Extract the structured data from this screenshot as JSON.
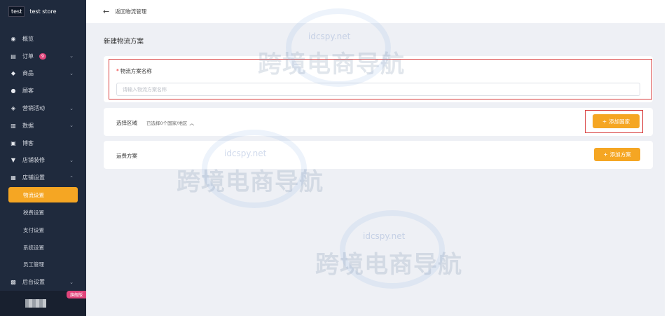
{
  "brand": {
    "logo": "test",
    "store_name": "test store"
  },
  "sidebar": {
    "items": [
      {
        "label": "概览",
        "icon": "dashboard-icon",
        "has_chevron": false
      },
      {
        "label": "订单",
        "icon": "order-icon",
        "badge": "9",
        "has_chevron": true
      },
      {
        "label": "商品",
        "icon": "product-icon",
        "has_chevron": true
      },
      {
        "label": "顾客",
        "icon": "customer-icon",
        "has_chevron": false
      },
      {
        "label": "营销活动",
        "icon": "tag-icon",
        "has_chevron": true
      },
      {
        "label": "数据",
        "icon": "chart-icon",
        "has_chevron": true
      },
      {
        "label": "博客",
        "icon": "blog-icon",
        "has_chevron": false
      },
      {
        "label": "店铺装修",
        "icon": "brush-icon",
        "has_chevron": true
      },
      {
        "label": "店铺设置",
        "icon": "store-icon",
        "has_chevron": true,
        "expanded": true
      }
    ],
    "sub_items": [
      {
        "label": "物流设置",
        "active": true
      },
      {
        "label": "税费设置"
      },
      {
        "label": "支付设置"
      },
      {
        "label": "系统设置"
      },
      {
        "label": "员工管理"
      }
    ],
    "last_item": {
      "label": "后台设置",
      "icon": "admin-icon",
      "has_chevron": true
    },
    "version_tag": "旗舰版"
  },
  "topbar": {
    "back_label": "返回物流管理"
  },
  "page": {
    "title": "新建物流方案"
  },
  "form": {
    "name_label": "物流方案名称",
    "name_placeholder": "请输入物流方案名称",
    "name_value": ""
  },
  "region_row": {
    "label": "选择区域",
    "meta": "已选择0个国家/地区",
    "add_button": "添加国家"
  },
  "shipping_row": {
    "label": "运费方案",
    "add_button": "添加方案"
  },
  "watermark": {
    "site": "idcspy.net",
    "text": "跨境电商导航"
  },
  "colors": {
    "accent": "#f5a623",
    "sidebar_bg": "#1f2a3d",
    "highlight": "#d94040",
    "badge": "#e0457b"
  }
}
